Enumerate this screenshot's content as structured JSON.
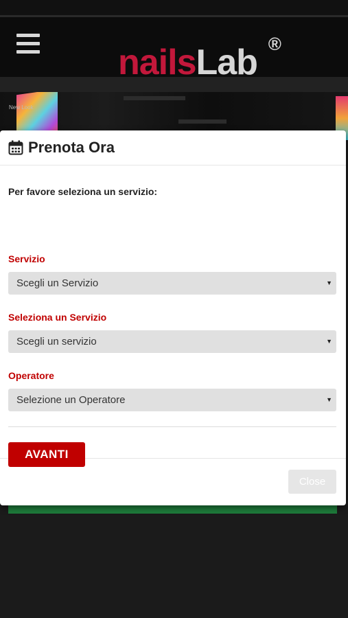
{
  "header": {
    "logo_part1": "nails",
    "logo_part2": "Lab",
    "logo_reg": "®"
  },
  "hero": {
    "label": "New Look"
  },
  "modal": {
    "title": "Prenota Ora",
    "intro": "Per favore seleziona un servizio:",
    "fields": [
      {
        "label": "Servizio",
        "value": "Scegli un Servizio"
      },
      {
        "label": "Seleziona un Servizio",
        "value": "Scegli un servizio"
      },
      {
        "label": "Operatore",
        "value": "Selezione un Operatore"
      }
    ],
    "next_label": "AVANTI",
    "close_label": "Close"
  },
  "colors": {
    "accent": "#c00000",
    "brand_pink": "#c2183b",
    "green_bar": "#1e7a3a"
  }
}
